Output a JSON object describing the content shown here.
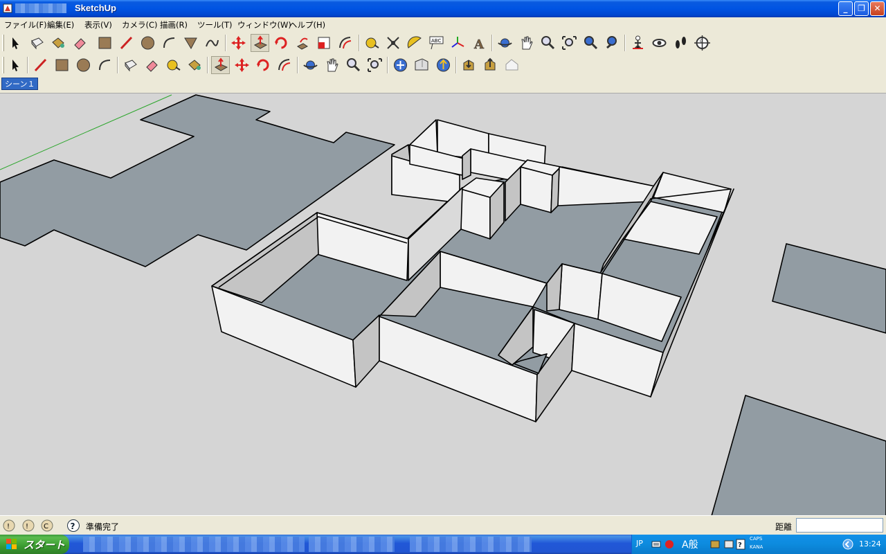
{
  "window": {
    "title": "SketchUp"
  },
  "menu": [
    "ファイル(F)",
    "編集(E)",
    "表示(V)",
    "カメラ(C)",
    "描画(R)",
    "ツール(T)",
    "ウィンドウ(W)",
    "ヘルプ(H)"
  ],
  "scene": {
    "tab_label": "シーン１"
  },
  "status": {
    "text": "準備完了",
    "measure_label": "距離",
    "measure_value": ""
  },
  "taskbar": {
    "start_label": "スタート",
    "lang": "JP",
    "ime": "A般",
    "caps": "CAPS",
    "kana": "KANA",
    "clock": "13:24"
  },
  "colors": {
    "title_blue": "#0054E3",
    "sky": "#D5D5D5",
    "floor": "#929CA3",
    "wall": "#F2F2F2",
    "wall_shade": "#C4C4C4"
  }
}
